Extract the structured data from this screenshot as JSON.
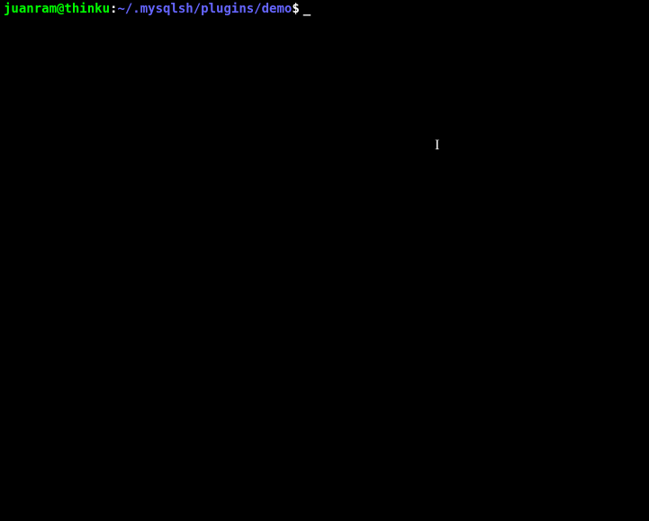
{
  "prompt": {
    "user_host": "juanram@thinku",
    "separator": ":",
    "path": "~/.mysqlsh/plugins/demo",
    "symbol": "$",
    "cursor": "_",
    "input": ""
  },
  "mouse_cursor": "I"
}
